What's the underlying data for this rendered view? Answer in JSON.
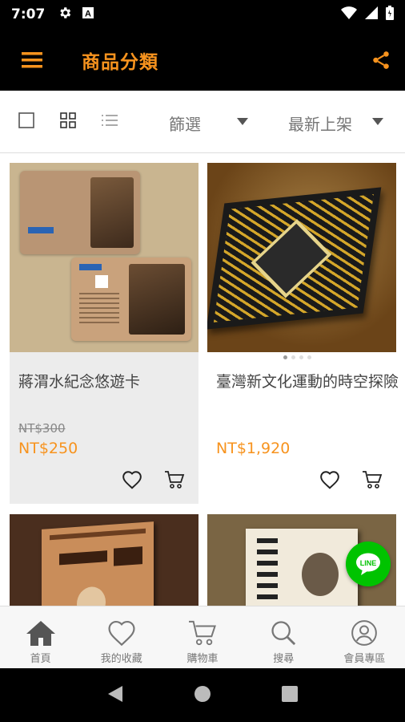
{
  "status_bar": {
    "time": "7:07"
  },
  "app_bar": {
    "title": "商品分類"
  },
  "toolbar": {
    "filter_label": "篩選",
    "sort_label": "最新上架"
  },
  "products": [
    {
      "name": "蔣渭水紀念悠遊卡",
      "old_price": "NT$300",
      "price": "NT$250"
    },
    {
      "name": "臺灣新文化運動的時空探險",
      "price": "NT$1,920"
    },
    {
      "name": "",
      "price": ""
    },
    {
      "name": "",
      "price": ""
    }
  ],
  "carousel": {
    "dots": 4,
    "active": 0
  },
  "bottom_nav": [
    {
      "label": "首頁",
      "icon": "home-icon"
    },
    {
      "label": "我的收藏",
      "icon": "heart-icon"
    },
    {
      "label": "購物車",
      "icon": "cart-icon"
    },
    {
      "label": "搜尋",
      "icon": "search-icon"
    },
    {
      "label": "會員專區",
      "icon": "user-icon"
    }
  ],
  "colors": {
    "accent": "#f7931e",
    "line": "#00c300",
    "bar": "#000000"
  },
  "line_button": {
    "label": "LINE"
  }
}
